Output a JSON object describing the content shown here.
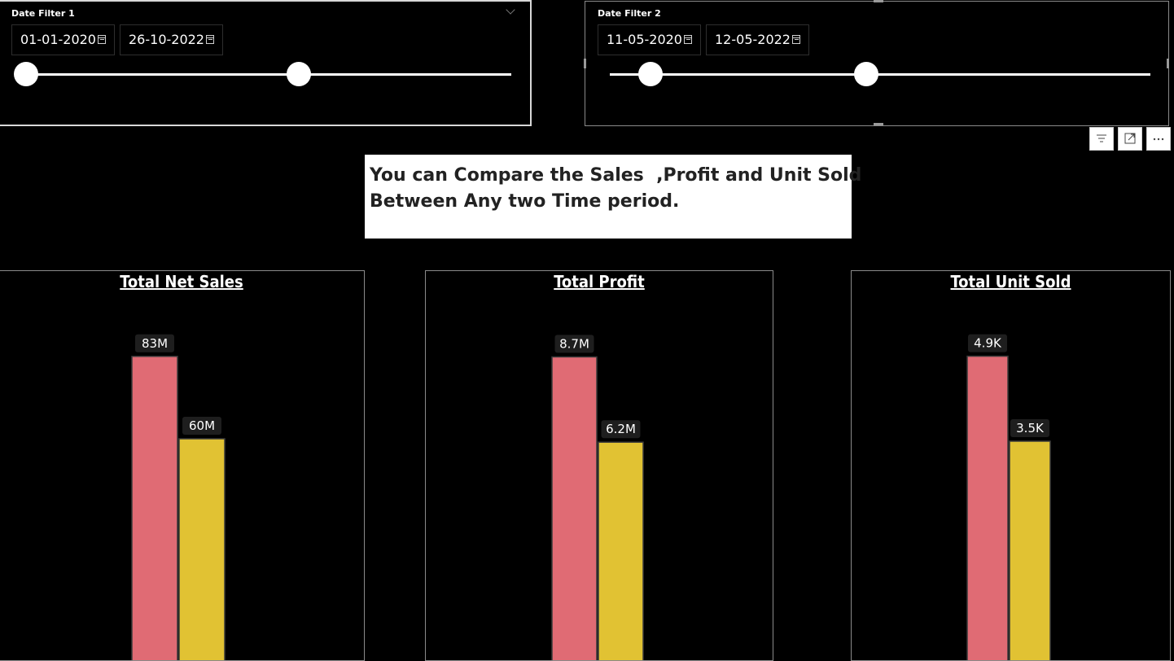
{
  "filters": [
    {
      "title": "Date Filter 1",
      "start": "01-01-2020",
      "end": "26-10-2022",
      "knob_positions": [
        0.0,
        0.55
      ]
    },
    {
      "title": "Date Filter 2",
      "start": "11-05-2020",
      "end": "12-05-2022",
      "knob_positions": [
        0.11,
        0.47
      ]
    }
  ],
  "visual_header_icons": [
    "filter-icon",
    "focus-mode-icon",
    "more-options-icon"
  ],
  "note": {
    "line1": "You can Compare the Sales  ,Profit and Unit Sold",
    "line2": "Between Any two Time period."
  },
  "colors": {
    "period1": "#E06B74",
    "period2": "#E1C233"
  },
  "chart_data": [
    {
      "type": "bar",
      "title": "Total Net Sales",
      "categories": [
        "",
        ""
      ],
      "values": [
        83,
        60
      ],
      "labels": [
        "83M",
        "60M"
      ],
      "unit": "M",
      "ylim": [
        0,
        100
      ]
    },
    {
      "type": "bar",
      "title": "Total Profit",
      "categories": [
        "",
        ""
      ],
      "values": [
        8.7,
        6.2
      ],
      "labels": [
        "8.7M",
        "6.2M"
      ],
      "unit": "M",
      "ylim": [
        0,
        10.5
      ]
    },
    {
      "type": "bar",
      "title": "Total Unit Sold",
      "categories": [
        "",
        ""
      ],
      "values": [
        4.9,
        3.5
      ],
      "labels": [
        "4.9K",
        "3.5K"
      ],
      "unit": "K",
      "ylim": [
        0,
        5.9
      ]
    }
  ]
}
